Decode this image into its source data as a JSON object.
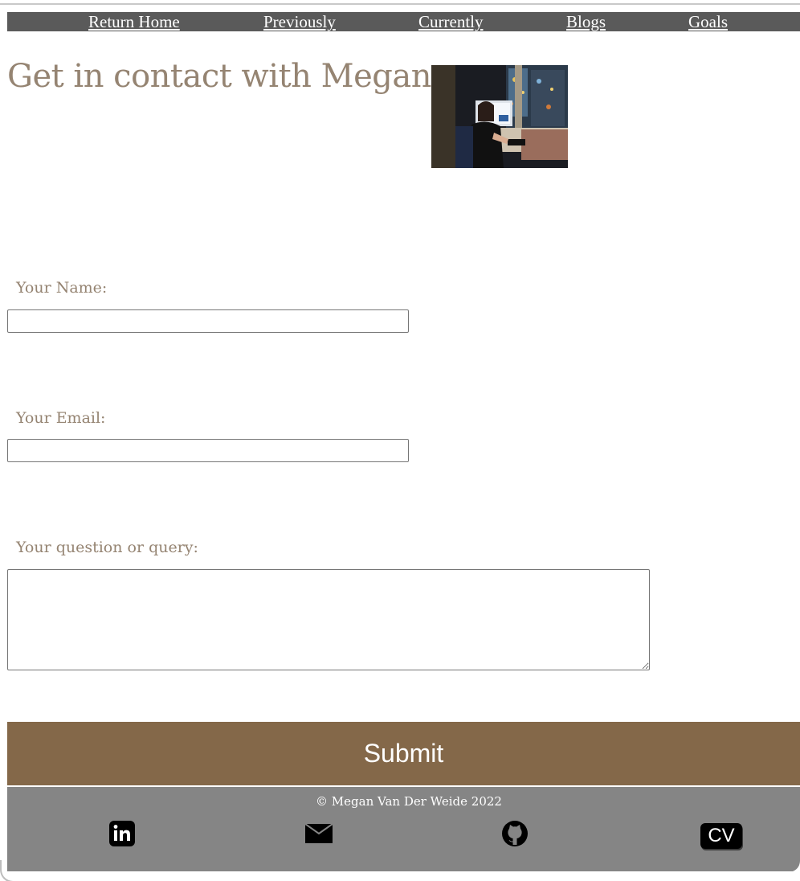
{
  "nav": {
    "items": [
      {
        "label": "Return Home"
      },
      {
        "label": "Previously"
      },
      {
        "label": "Currently"
      },
      {
        "label": "Blogs"
      },
      {
        "label": "Goals"
      }
    ]
  },
  "header": {
    "title": "Get in contact with Megan"
  },
  "form": {
    "name_label": "Your Name:",
    "name_value": "",
    "email_label": "Your Email:",
    "email_value": "",
    "query_label": "Your question or query:",
    "query_value": "",
    "submit_label": "Submit"
  },
  "footer": {
    "copyright": "© Megan Van Der Weide 2022",
    "icons": [
      "linkedin-icon",
      "email-icon",
      "github-icon",
      "cv-icon"
    ],
    "cv_label": "CV"
  },
  "colors": {
    "nav_background": "#5a5a5a",
    "heading_text": "#958472",
    "submit_background": "#846849",
    "footer_background": "#858585"
  }
}
